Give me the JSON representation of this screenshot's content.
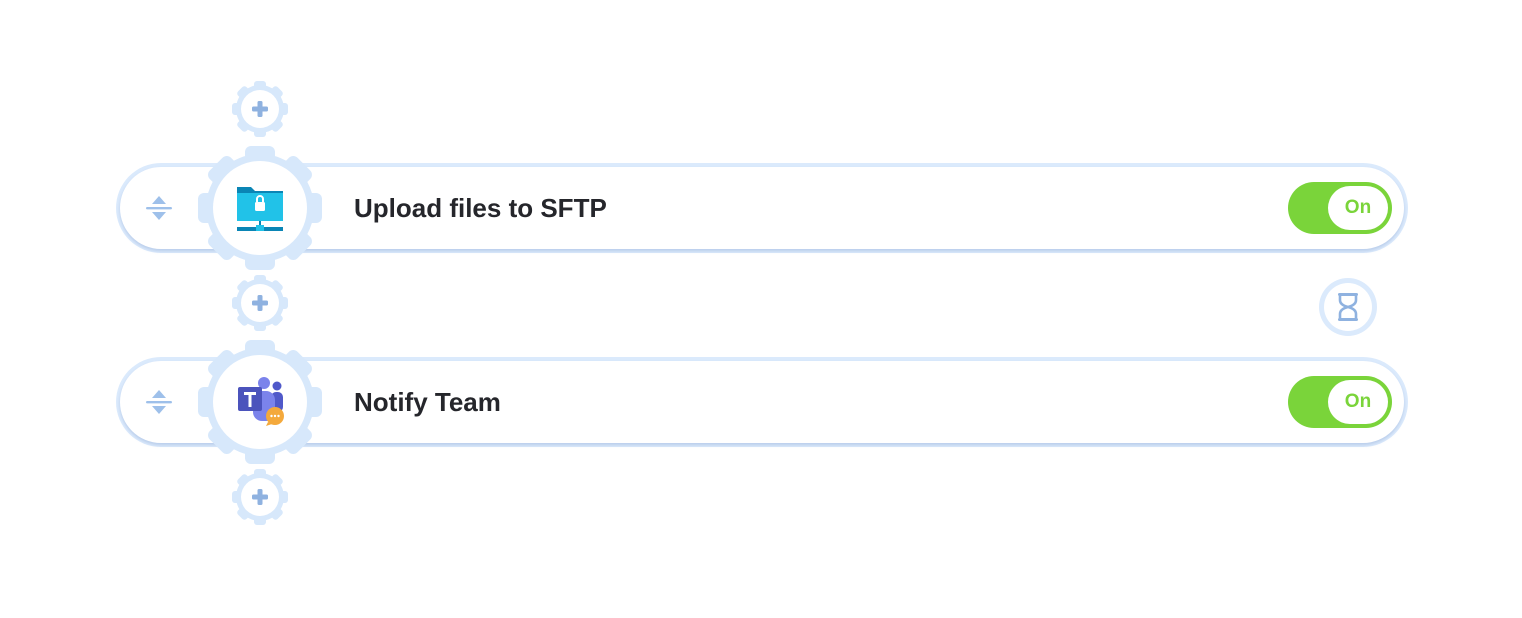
{
  "steps": [
    {
      "title": "Upload files to SFTP",
      "toggle_label": "On",
      "enabled": true,
      "icon": "sftp-folder-lock-icon"
    },
    {
      "title": "Notify Team",
      "toggle_label": "On",
      "enabled": true,
      "icon": "microsoft-teams-icon"
    }
  ],
  "colors": {
    "gear": "#d7e8fb",
    "plus": "#8fb2e0",
    "toggle_on": "#7ad43a",
    "title_text": "#25262b",
    "card_border": "#dbeafc"
  },
  "add_step_icon": "plus-icon",
  "delay_icon": "hourglass-icon",
  "drag_icon": "drag-handle-icon"
}
